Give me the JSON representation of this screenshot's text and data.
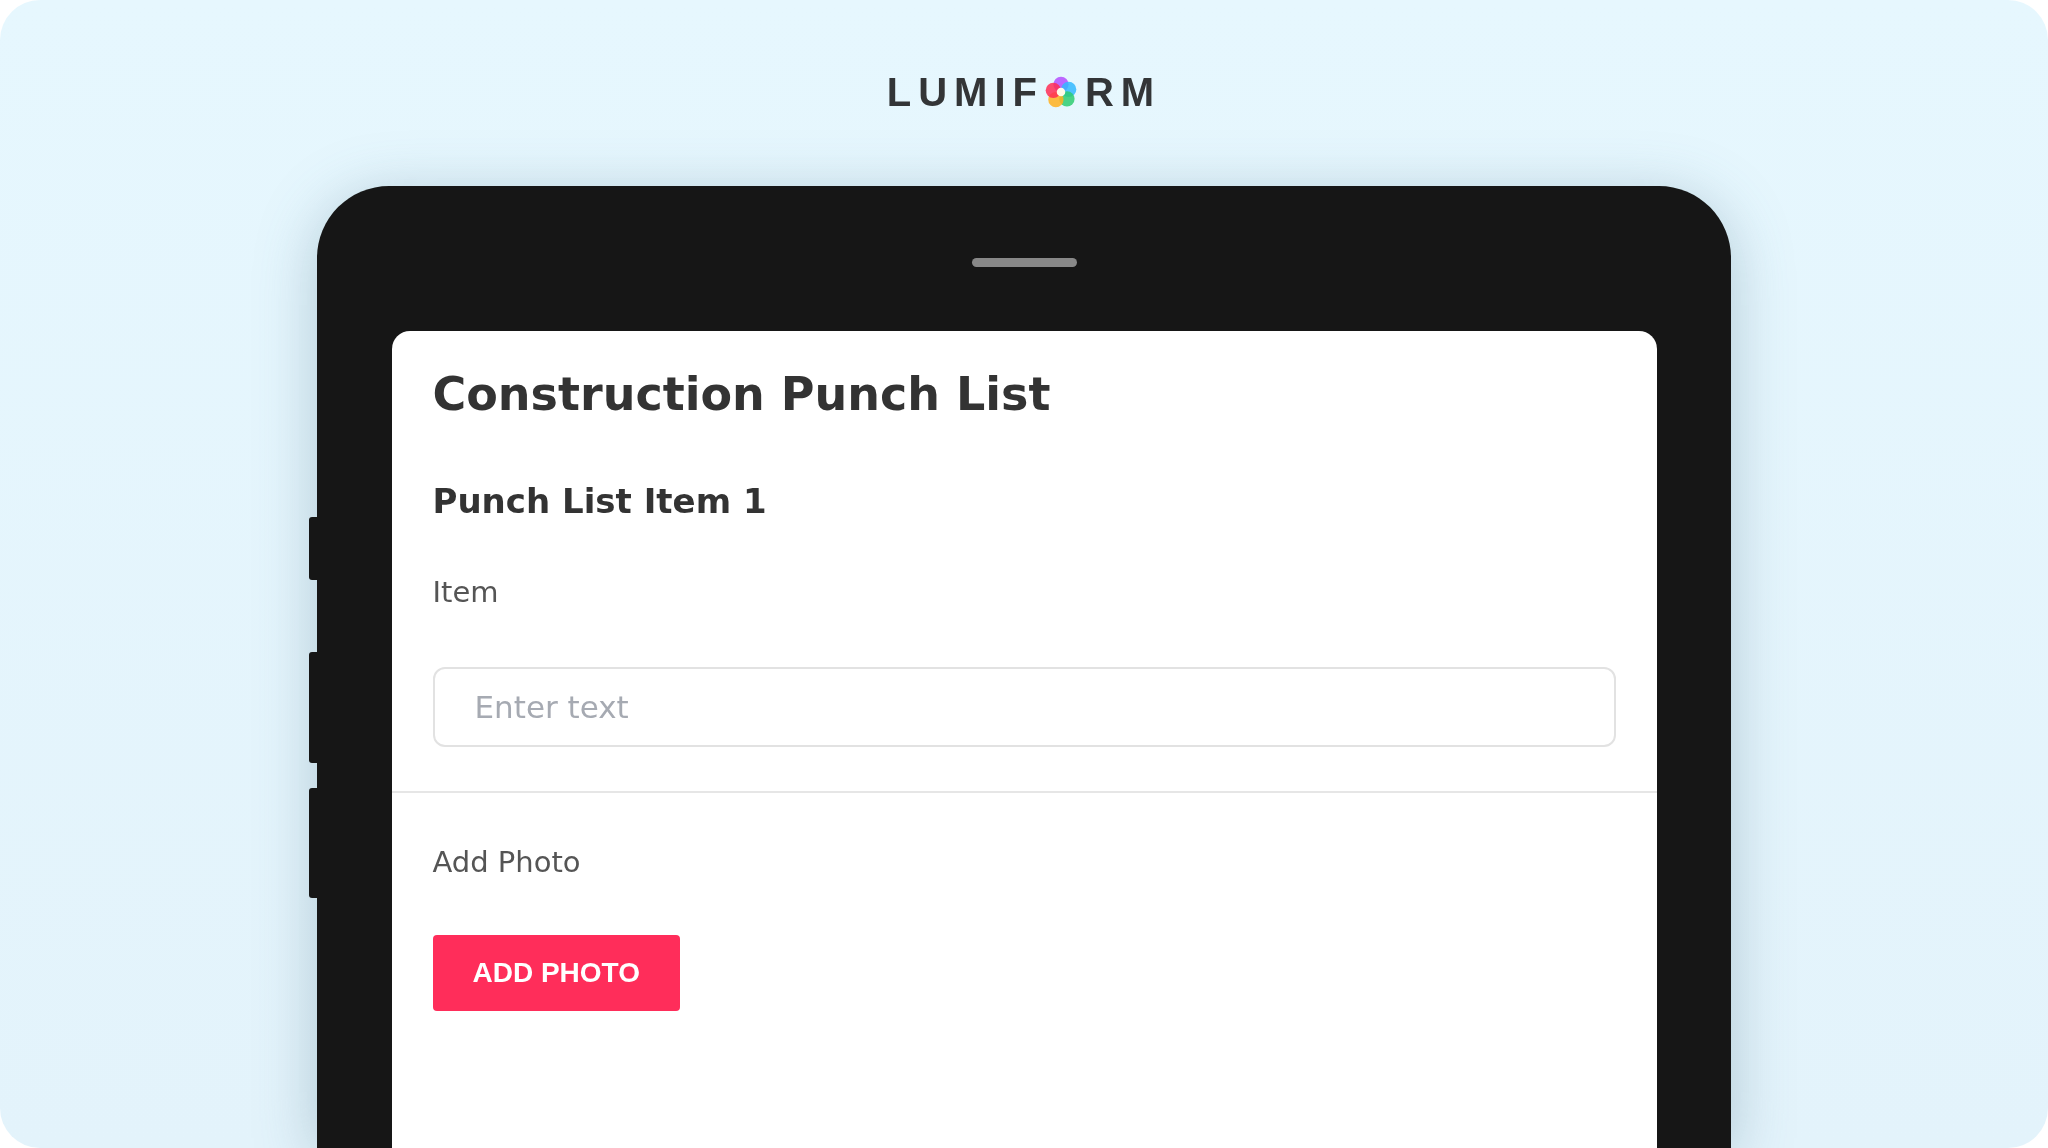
{
  "logo": {
    "before": "LUMIF",
    "after": "RM"
  },
  "form": {
    "title": "Construction Punch List",
    "section": "Punch List Item 1",
    "fields": [
      {
        "kind": "text",
        "label": "Item",
        "placeholder": "Enter text"
      },
      {
        "kind": "photo",
        "label": "Add Photo",
        "button": "ADD PHOTO"
      }
    ]
  }
}
